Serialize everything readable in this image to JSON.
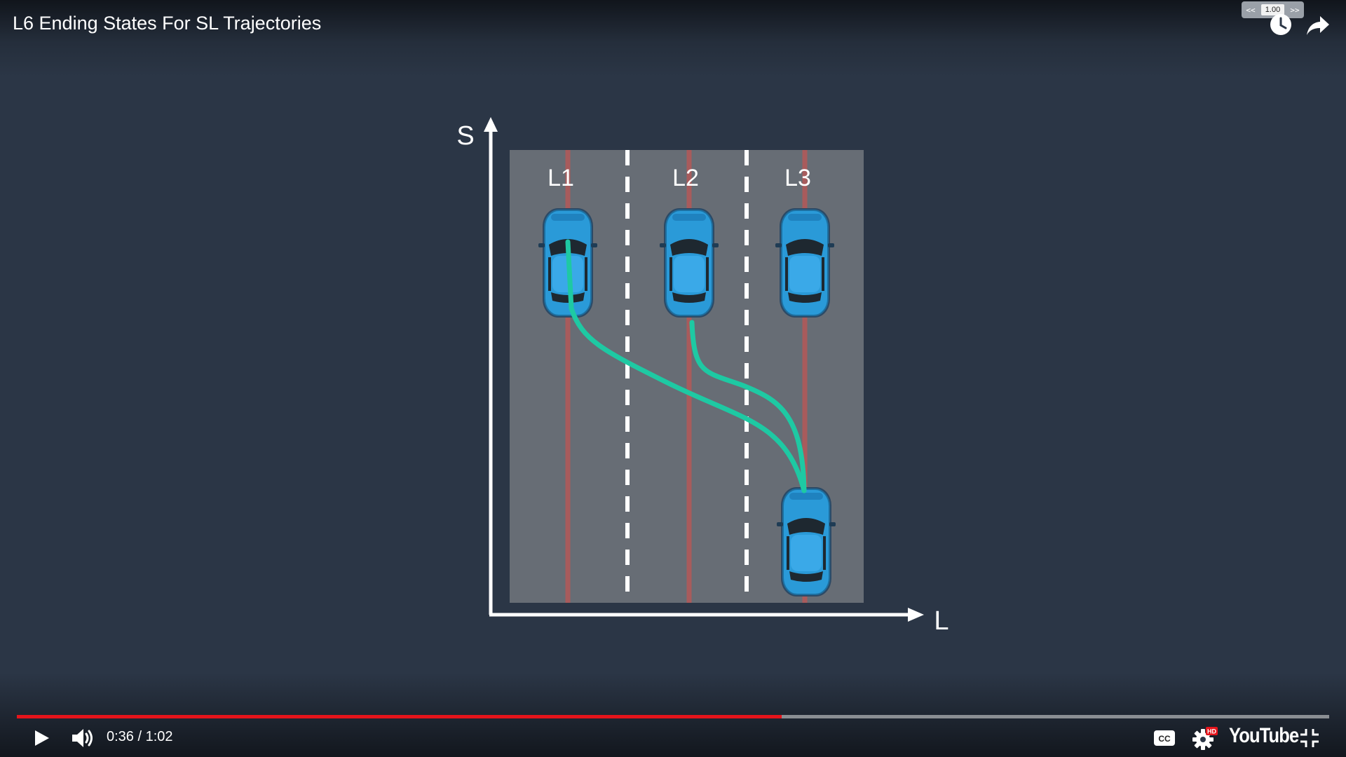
{
  "player": {
    "title": "L6 Ending States For SL Trajectories",
    "speed": {
      "decrease_label": "<<",
      "value": "1.00",
      "increase_label": ">>"
    },
    "progress": {
      "played_fraction": 0.583
    },
    "time": {
      "current": "0:36",
      "separator": "/",
      "duration": "1:02"
    },
    "brand": "YouTube",
    "settings_badge": "HD",
    "colors": {
      "played": "#e5141b",
      "background": "#2b3646"
    }
  },
  "diagram": {
    "axis_s": "S",
    "axis_l": "L",
    "lanes": [
      "L1",
      "L2",
      "L3"
    ],
    "colors": {
      "road": "#676d75",
      "lane_center": "#b45858",
      "trajectory": "#1ec9a3",
      "car": "#2a9ad8",
      "axis": "#ffffff"
    }
  },
  "icons": {
    "watch_later": "clock-icon",
    "share": "share-arrow-icon",
    "play": "play-icon",
    "volume": "speaker-icon",
    "captions": "cc-icon",
    "settings": "gear-icon",
    "exit_fullscreen": "exit-fullscreen-icon"
  }
}
